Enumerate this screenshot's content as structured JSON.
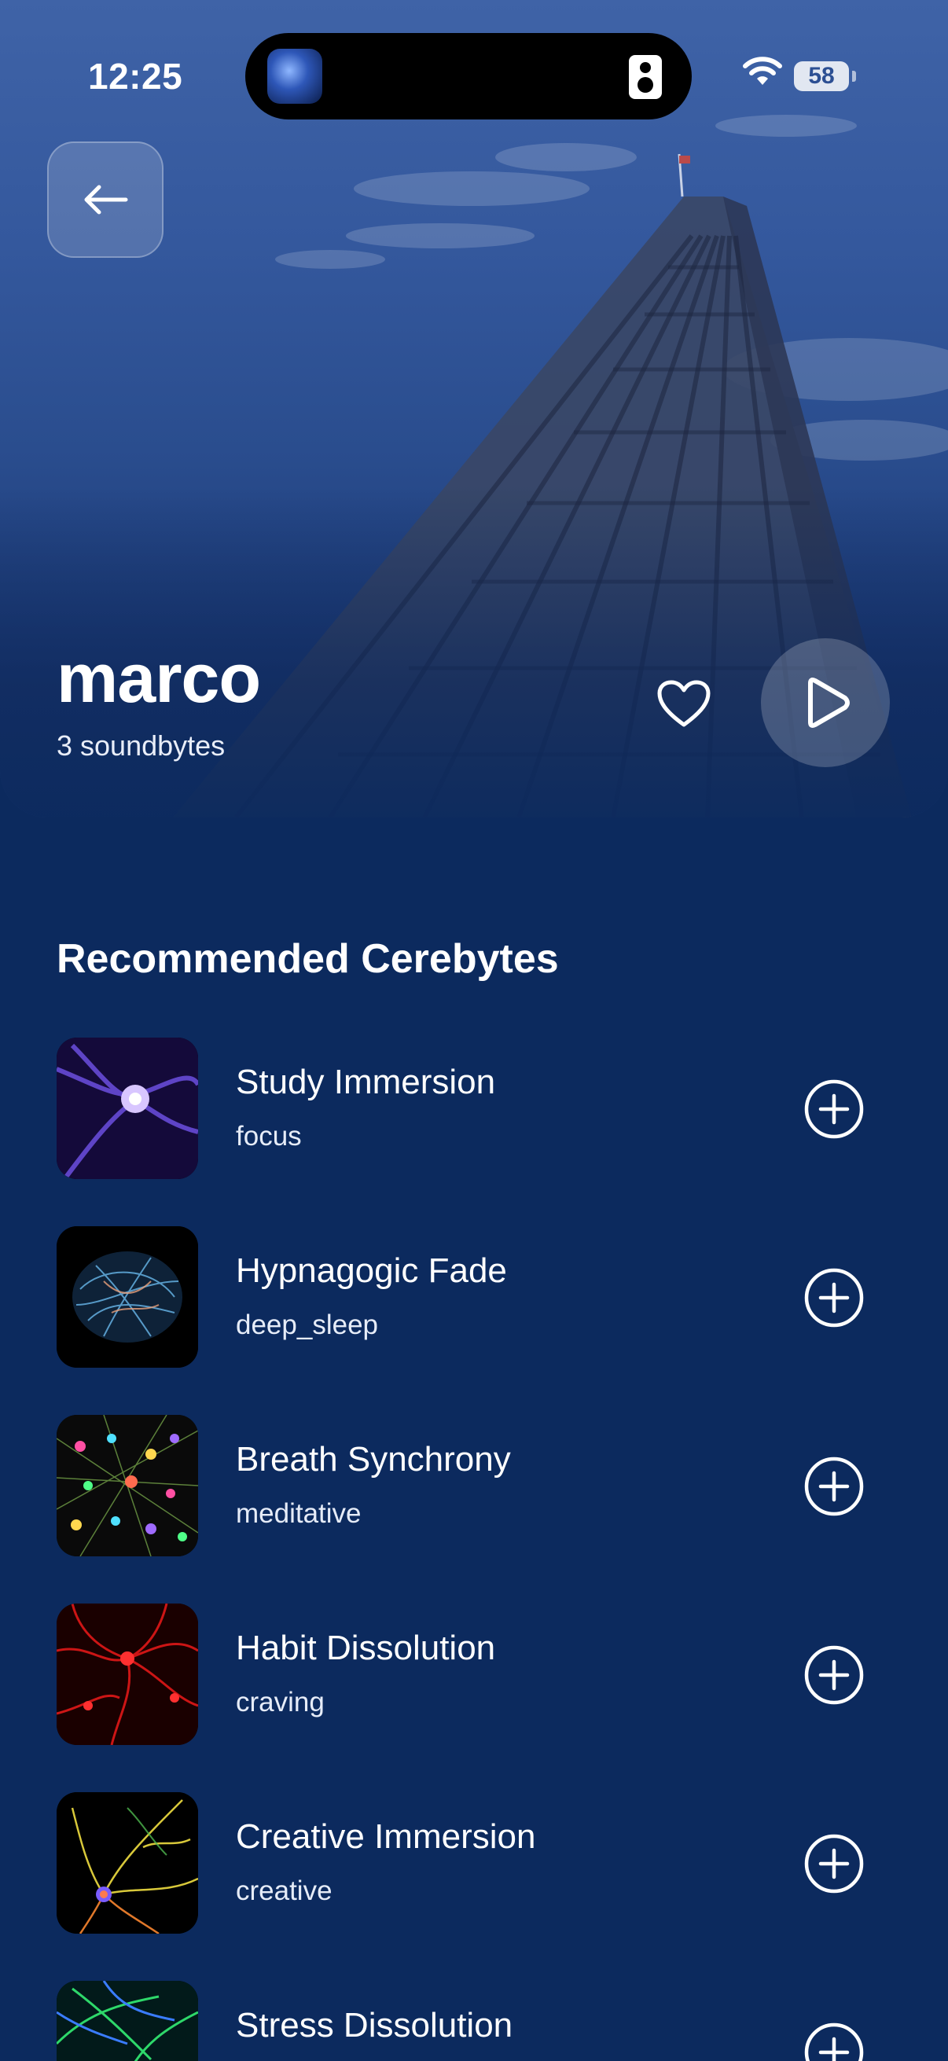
{
  "status": {
    "time": "12:25",
    "battery": "58"
  },
  "profile": {
    "name": "marco",
    "count_label": "3 soundbytes"
  },
  "section": {
    "title": "Recommended Cerebytes"
  },
  "items": [
    {
      "title": "Study Immersion",
      "category": "focus",
      "thumb": "purple-neuron"
    },
    {
      "title": "Hypnagogic Fade",
      "category": "deep_sleep",
      "thumb": "neural-network-globe"
    },
    {
      "title": "Breath Synchrony",
      "category": "meditative",
      "thumb": "colorful-neurons"
    },
    {
      "title": "Habit Dissolution",
      "category": "craving",
      "thumb": "red-neurons"
    },
    {
      "title": "Creative Immersion",
      "category": "creative",
      "thumb": "single-neuron-branches"
    },
    {
      "title": "Stress Dissolution",
      "category": "",
      "thumb": "green-blue-neurons"
    }
  ],
  "icons": [
    "back-arrow-icon",
    "heart-icon",
    "play-icon",
    "plus-circle-icon",
    "wifi-icon"
  ],
  "colors": {
    "background": "#0c2a5e",
    "accent": "#ffffff"
  }
}
